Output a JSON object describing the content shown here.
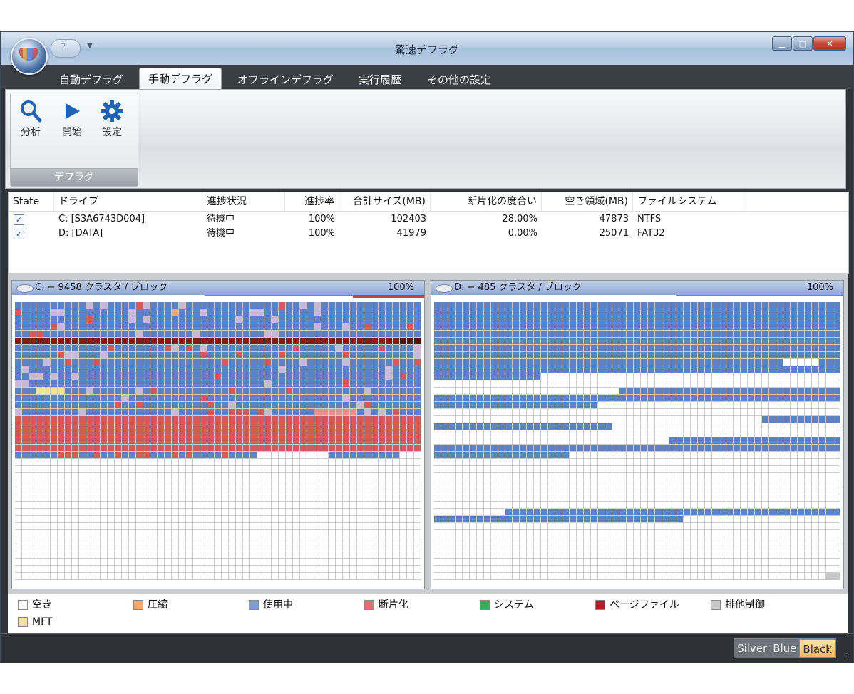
{
  "window": {
    "title": "驚速デフラグ",
    "min": "▁",
    "max": "□",
    "close": "✕"
  },
  "tabs": [
    "自動デフラグ",
    "手動デフラグ",
    "オフラインデフラグ",
    "実行履歴",
    "その他の設定"
  ],
  "active_tab": 1,
  "ribbon": {
    "buttons": [
      {
        "label": "分析",
        "icon": "magnifier-icon"
      },
      {
        "label": "開始",
        "icon": "play-icon"
      },
      {
        "label": "設定",
        "icon": "gear-icon"
      }
    ],
    "group_label": "デフラグ"
  },
  "drive_list": {
    "columns": [
      "State",
      "ドライブ",
      "進捗状況",
      "進捗率",
      "合計サイズ(MB)",
      "断片化の度合い",
      "空き領域(MB)",
      "ファイルシステム"
    ],
    "rows": [
      {
        "checked": true,
        "drive": "C: [S3A6743D004]",
        "status": "待機中",
        "progress": "100%",
        "total": "102403",
        "fragmentation": "28.00%",
        "free": "47873",
        "fs": "NTFS"
      },
      {
        "checked": true,
        "drive": "D: [DATA]",
        "status": "待機中",
        "progress": "100%",
        "total": "41979",
        "fragmentation": "0.00%",
        "free": "25071",
        "fs": "FAT32"
      }
    ]
  },
  "maps": [
    {
      "title": "C: − 9458 クラスタ / ブロック",
      "percent": "100%"
    },
    {
      "title": "D: − 485 クラスタ / ブロック",
      "percent": "100%"
    }
  ],
  "legend": [
    {
      "label": "空き",
      "color": "#ffffff"
    },
    {
      "label": "圧縮",
      "color": "#f2a870"
    },
    {
      "label": "使用中",
      "color": "#7f9ed8"
    },
    {
      "label": "断片化",
      "color": "#e07070"
    },
    {
      "label": "システム",
      "color": "#3aaa5a"
    },
    {
      "label": "ページファイル",
      "color": "#b82020"
    },
    {
      "label": "排他制御",
      "color": "#c8c8c8"
    },
    {
      "label": "MFT",
      "color": "#f4e48a"
    }
  ],
  "skins": [
    "Silver",
    "Blue",
    "Black"
  ],
  "active_skin": 2,
  "colors": {
    "used": "#5b82c9",
    "frag": "#d9575a",
    "pagefile": "#8a1a1a",
    "free": "#ffffff",
    "gridline": "#c9ccd0"
  }
}
